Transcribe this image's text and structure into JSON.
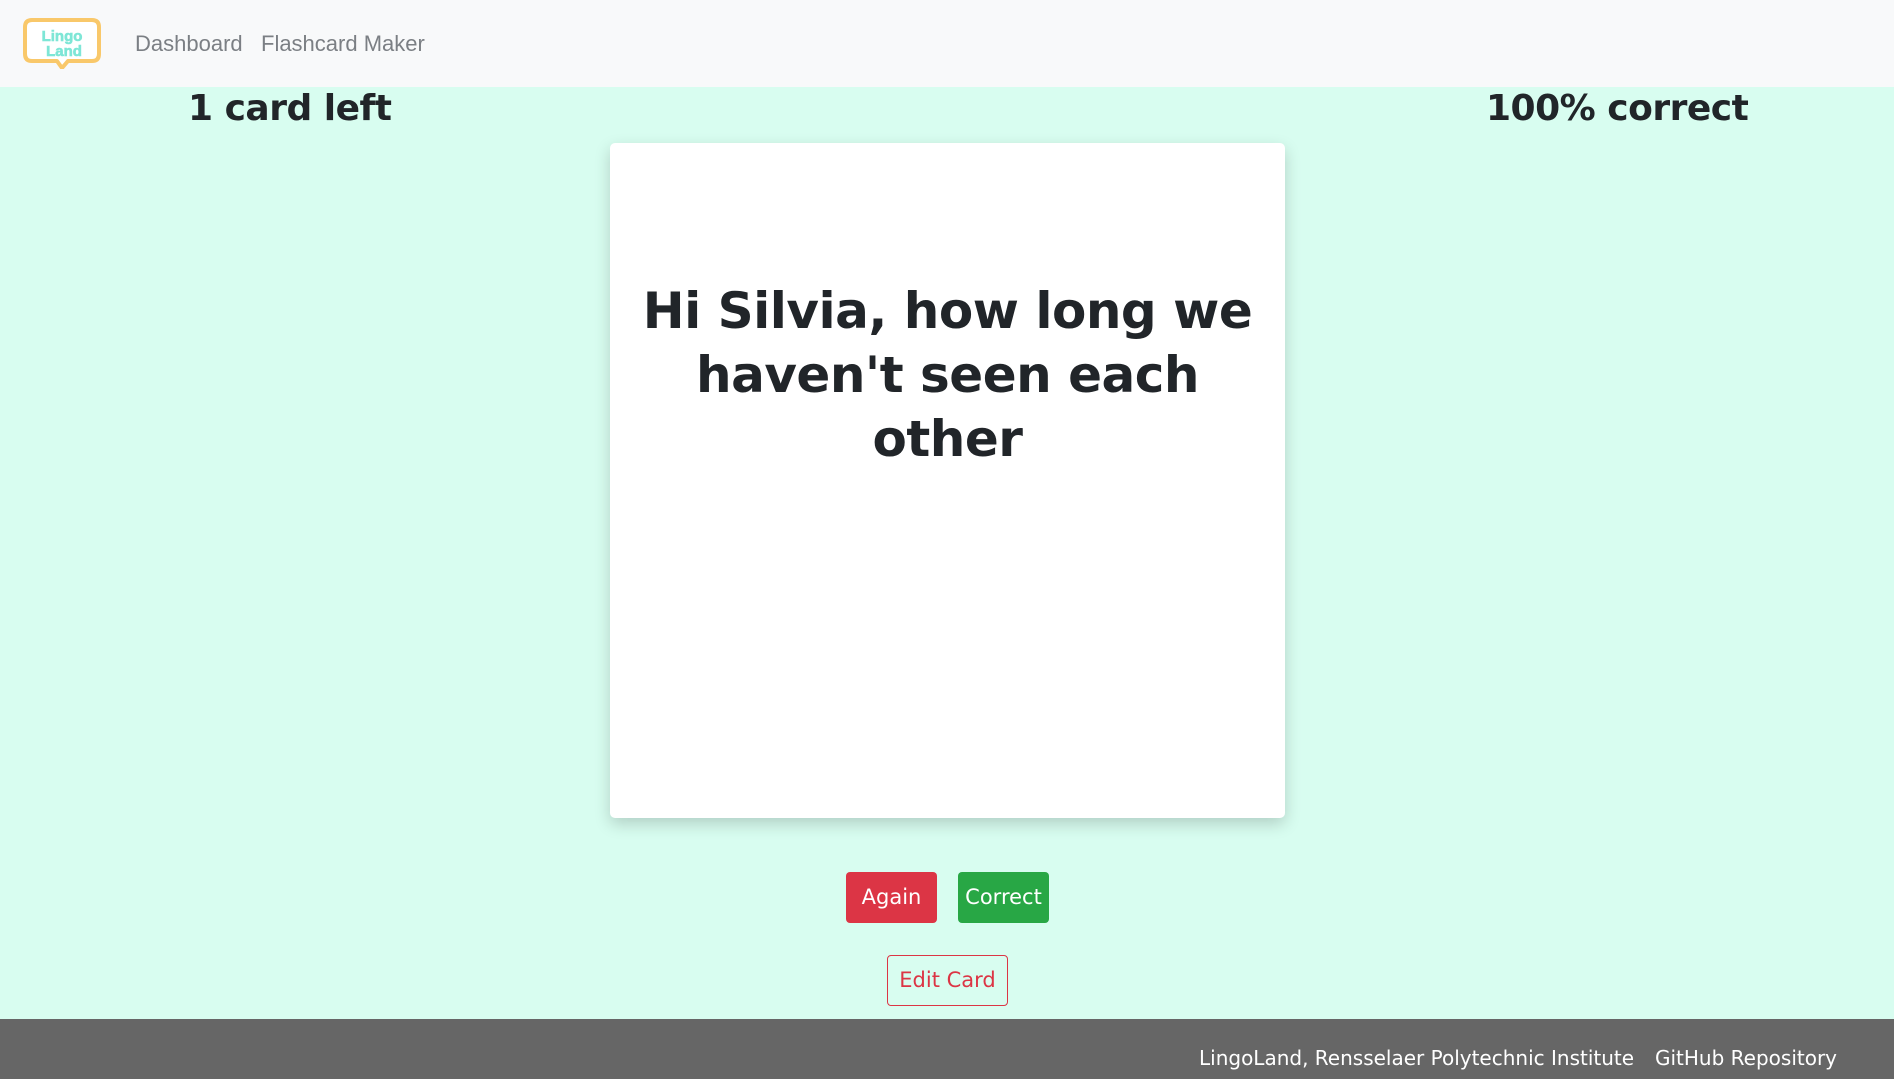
{
  "nav": {
    "logo_text": "Lingo Land",
    "items": [
      {
        "label": "Dashboard"
      },
      {
        "label": "Flashcard Maker"
      }
    ]
  },
  "stats": {
    "cards_left": "1 card left",
    "percent_correct": "100% correct"
  },
  "card": {
    "line1": "Hi Silvia, how long we",
    "line2": "haven't seen each other"
  },
  "actions": {
    "again_label": "Again",
    "correct_label": "Correct",
    "edit_label": "Edit Card"
  },
  "footer": {
    "institution": "LingoLand, Rensselaer Polytechnic Institute",
    "repo": "GitHub Repository"
  },
  "colors": {
    "background": "#d8fdf0",
    "navbar": "#f8f9fa",
    "danger": "#dc3545",
    "success": "#28a745",
    "footer": "#666666",
    "logo_frame": "#f9c86a",
    "logo_text": "#7ee6d6"
  },
  "icons": {
    "logo": "lingoland-speech-bubble-logo"
  }
}
